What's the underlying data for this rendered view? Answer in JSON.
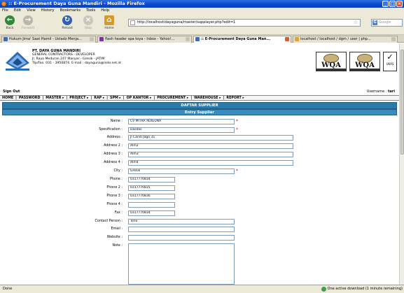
{
  "window": {
    "title": ":: E-Procurement Daya Guna Mandiri - Mozilla Firefox"
  },
  "menubar": [
    "File",
    "Edit",
    "View",
    "History",
    "Bookmarks",
    "Tools",
    "Help"
  ],
  "toolbar": {
    "back": "Back",
    "forward": "Forward",
    "reload": "Reload",
    "stop": "Stop",
    "home": "Home",
    "url": "http://localhost/dayaguna/master/supplayer.php?edit=1",
    "search_placeholder": "Google"
  },
  "tabs": [
    {
      "label": "Hukum Jima' Saat Hamil - Ustadz Menja...",
      "icon_color": "#3b6db5"
    },
    {
      "label": "flash header spa toya - Inbox - Yahoo!...",
      "icon_color": "#7b2fa8"
    },
    {
      "label": ":: E-Procurement Daya Guna Man...",
      "icon_color": "#3b6db5",
      "active": true
    },
    {
      "label": "localhost / localhost / dgm / user | php...",
      "icon_color": "#e8a02d"
    }
  ],
  "header": {
    "company_name": "PT. DAYA GUNA MANDIRI",
    "company_line1": "GENERAL CONTRACTORS - DEVELOPER",
    "company_line2": "Jl. Raya Meduran 247 Manyar - Gresik - JATIM",
    "company_line3": "Tlp/Fax. 031 - 3950874. E-mail : dayaguna@indo.net.id",
    "cert1": "WQA",
    "cert2": "WQA",
    "cert3": "UKAS"
  },
  "session": {
    "sign_out": "Sign Out",
    "username_label": "Username :",
    "username": "tari"
  },
  "nav": [
    "HOME",
    "PASSWORD",
    "MASTER ▸",
    "PROJECT ▸",
    "RAP ▸",
    "SPM ▸",
    "OP KANTOR ▸",
    "PROCUREMENT ▸",
    "WAREHOUSE ▸",
    "REPORT ▸"
  ],
  "page": {
    "title": "DAFTAR SUPPLIER",
    "subtitle": "Entry Supplier"
  },
  "form": {
    "name": {
      "label": "Name :",
      "value": "CV MITRA ADIGUNA"
    },
    "spesification": {
      "label": "Spesification :",
      "value": "Dasdas"
    },
    "address": {
      "label": "Address :",
      "value": "Jl Candi Jago 35"
    },
    "address2": {
      "label": "Address 2 :",
      "value": "Alm2"
    },
    "address3": {
      "label": "Address 3 :",
      "value": "Alm3"
    },
    "address4": {
      "label": "Address 4 :",
      "value": "Alm4"
    },
    "city": {
      "label": "City :",
      "value": "Gresik"
    },
    "phone": {
      "label": "Phone :",
      "value": "0317770834"
    },
    "phone2": {
      "label": "Phone 2 :",
      "value": "0317770835"
    },
    "phone3": {
      "label": "Phone 3 :",
      "value": "0317770836"
    },
    "phone4": {
      "label": "Phone 4 :",
      "value": ""
    },
    "fax": {
      "label": "Fax :",
      "value": "0317770834"
    },
    "contact": {
      "label": "Contact Person :",
      "value": "Tono"
    },
    "email": {
      "label": "Email :",
      "value": ""
    },
    "website": {
      "label": "Website :",
      "value": ""
    },
    "note": {
      "label": "Note :",
      "value": ""
    }
  },
  "required_mark": "*",
  "status": {
    "left": "Done",
    "right": "One active download (1 minute remaining)"
  }
}
